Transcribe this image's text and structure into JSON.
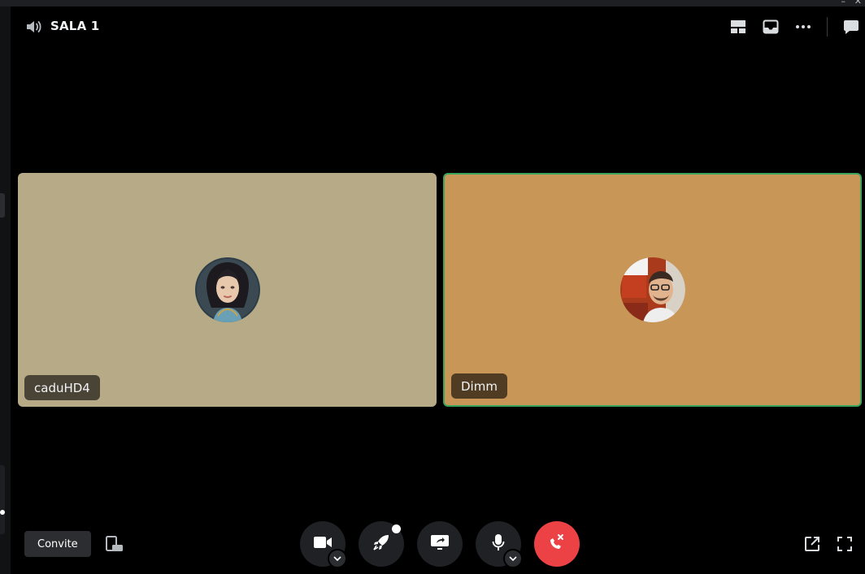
{
  "window": {
    "controls": [
      "–",
      "✕"
    ]
  },
  "header": {
    "room_title": "SALA 1",
    "room_icon": "speaker-icon",
    "actions": [
      "layout-grid-icon",
      "inbox-icon",
      "more-dots-icon",
      "chat-bubble-icon"
    ]
  },
  "participants": [
    {
      "name": "caduHD4",
      "tile_color": "#b6aa87",
      "speaking": false
    },
    {
      "name": "Dimm",
      "tile_color": "#c89656",
      "speaking": true,
      "speaking_border": "#3ba55d"
    }
  ],
  "footer": {
    "invite_label": "Convite",
    "popout_icon": "device-popout-icon",
    "controls": [
      "camera-icon",
      "activity-rocket-icon",
      "screen-share-icon",
      "microphone-icon",
      "hang-up-icon"
    ],
    "right_icons": [
      "pop-out-icon",
      "fullscreen-icon"
    ],
    "hangup_color": "#ed4245"
  }
}
